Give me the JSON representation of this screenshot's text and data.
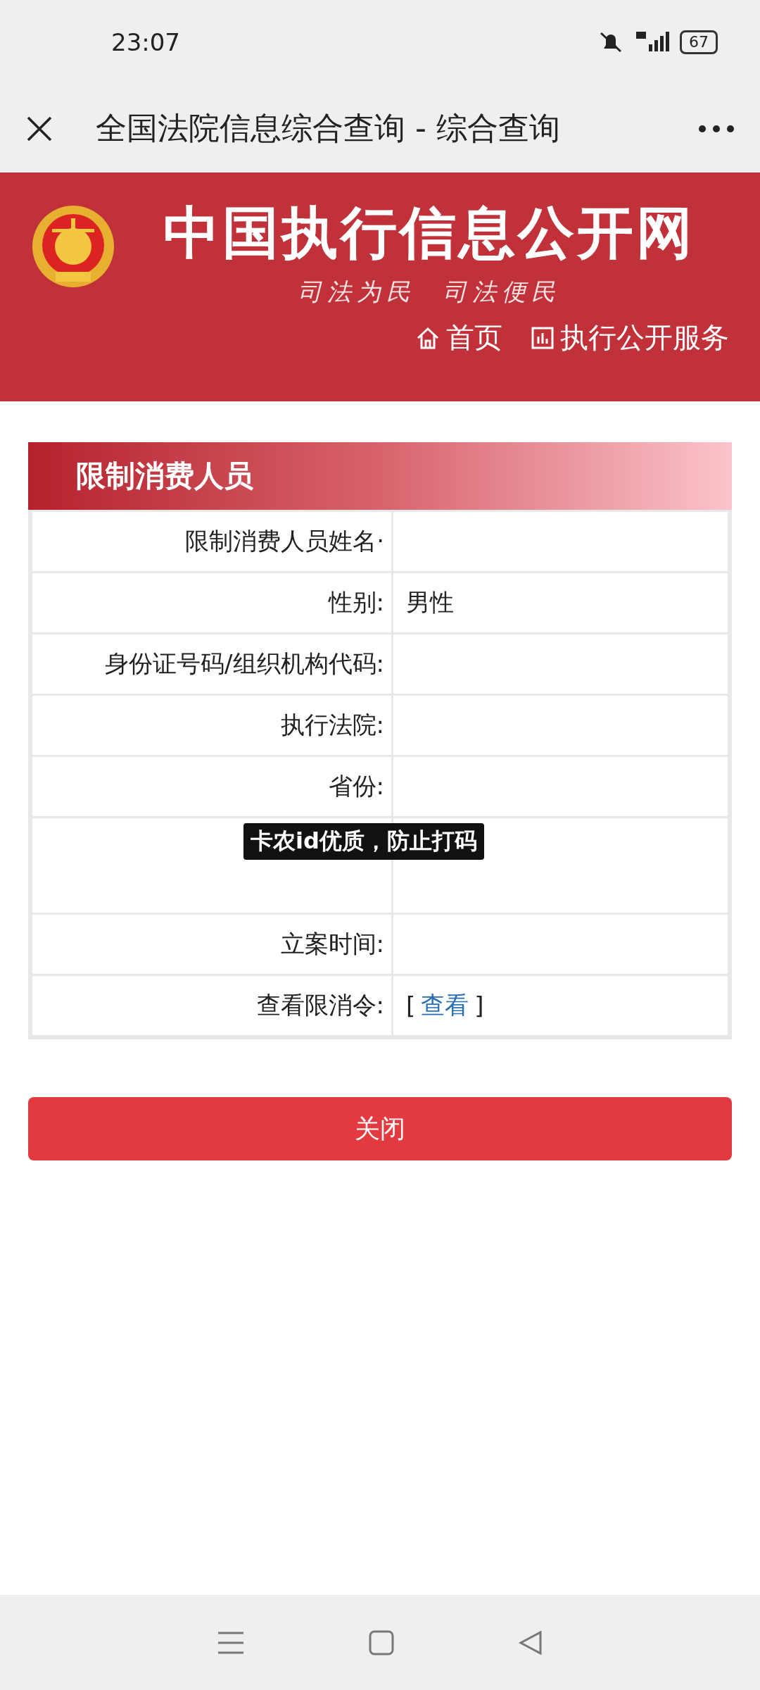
{
  "status_bar": {
    "time": "23:07",
    "battery": "67"
  },
  "title_bar": {
    "title": "全国法院信息综合查询 - 综合查询"
  },
  "banner": {
    "site_name": "中国执行信息公开网",
    "slogan": "司法为民  司法便民",
    "links": [
      {
        "label": "首页"
      },
      {
        "label": "执行公开服务"
      }
    ]
  },
  "section": {
    "title": "限制消费人员",
    "rows": [
      {
        "kind": "text",
        "label": "限制消费人员姓名·"
      },
      {
        "kind": "text",
        "label": "性别:",
        "value": "男性"
      },
      {
        "kind": "text",
        "label": "身份证号码/组织机构代码:"
      },
      {
        "kind": "text",
        "label": "执行法院:"
      },
      {
        "kind": "text",
        "label": "省份:"
      },
      {
        "kind": "tall"
      },
      {
        "kind": "text",
        "label": "立案时间:"
      },
      {
        "kind": "link",
        "label": "查看限消令:",
        "link_prefix": "[",
        "link": "查看",
        "link_suffix": "]"
      }
    ]
  },
  "overlay_caption": "卡农id优质，防止打码",
  "close_button": "关闭"
}
